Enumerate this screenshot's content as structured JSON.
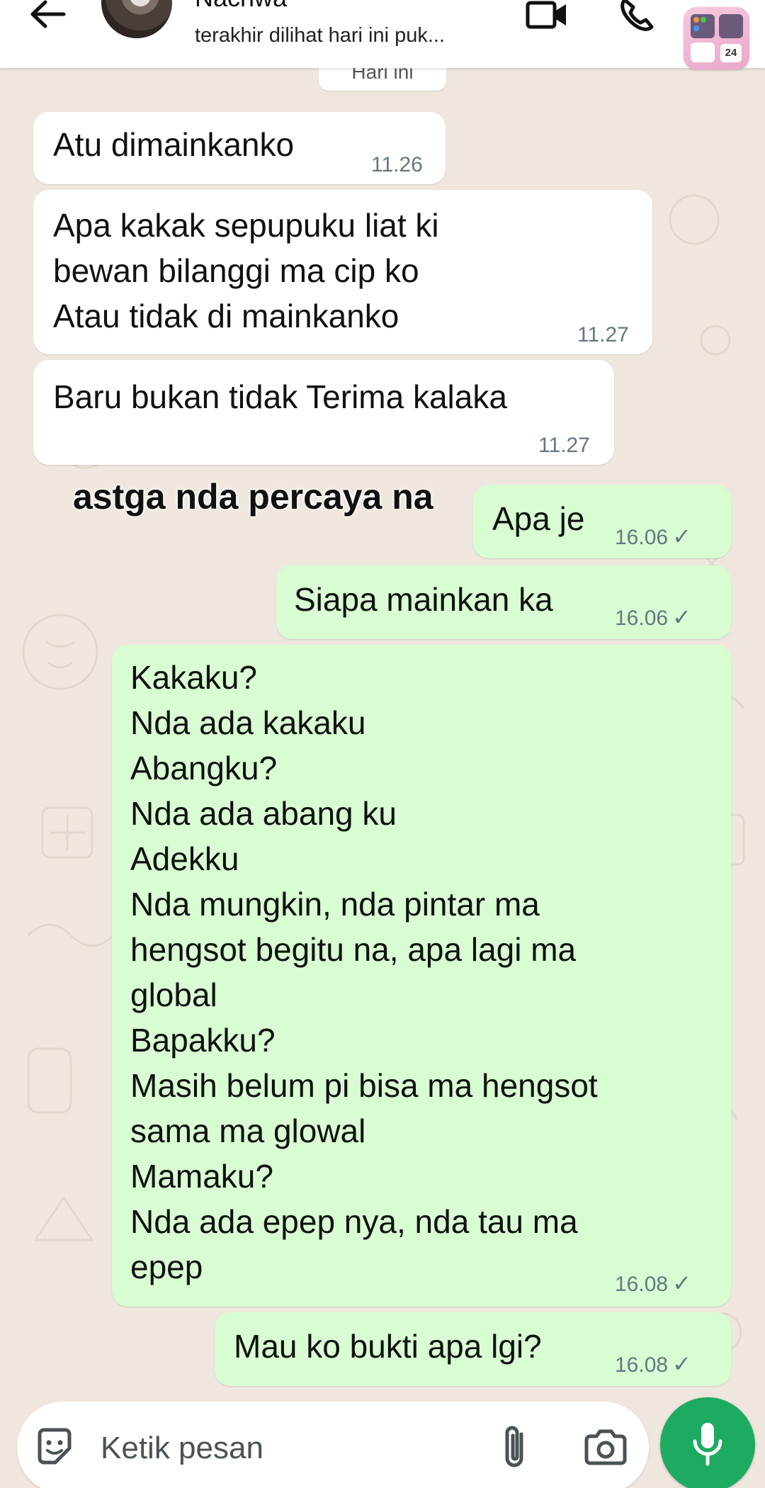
{
  "header": {
    "contact_name": "Nachwa",
    "status": "terakhir dilihat hari ini puk...",
    "widget_number": "24"
  },
  "date_separator": "Hari ini",
  "overlay_caption": "astga nda percaya na",
  "messages": [
    {
      "direction": "in",
      "text": "Atu dimainkanko",
      "time": "11.26"
    },
    {
      "direction": "in",
      "text": "Apa kakak sepupuku liat ki\nbewan bilanggi ma cip ko\nAtau tidak di mainkanko",
      "time": "11.27"
    },
    {
      "direction": "in",
      "text": "Baru bukan tidak Terima kalaka",
      "time": "11.27"
    },
    {
      "direction": "out",
      "text": "Apa je",
      "time": "16.06"
    },
    {
      "direction": "out",
      "text": "Siapa mainkan ka",
      "time": "16.06"
    },
    {
      "direction": "out",
      "text": "Kakaku?\nNda  ada kakaku\nAbangku?\nNda ada abang ku\nAdekku\nNda mungkin, nda pintar ma\nhengsot begitu na, apa lagi ma\nglobal\nBapakku?\nMasih belum pi bisa ma hengsot\nsama ma glowal\nMamaku?\nNda ada epep nya, nda tau ma\nepep",
      "time": "16.08"
    },
    {
      "direction": "out",
      "text": "Mau ko bukti apa lgi?",
      "time": "16.08"
    }
  ],
  "read_tick": "✓",
  "input": {
    "placeholder": "Ketik pesan"
  },
  "colors": {
    "incoming_bubble": "#ffffff",
    "outgoing_bubble": "#d8fdd2",
    "chat_background": "#efe7dd",
    "mic_button": "#1dab61",
    "timestamp": "#667781"
  },
  "icons": [
    "back-arrow-icon",
    "video-call-icon",
    "phone-icon",
    "sticker-icon",
    "paperclip-icon",
    "camera-icon",
    "mic-icon"
  ]
}
